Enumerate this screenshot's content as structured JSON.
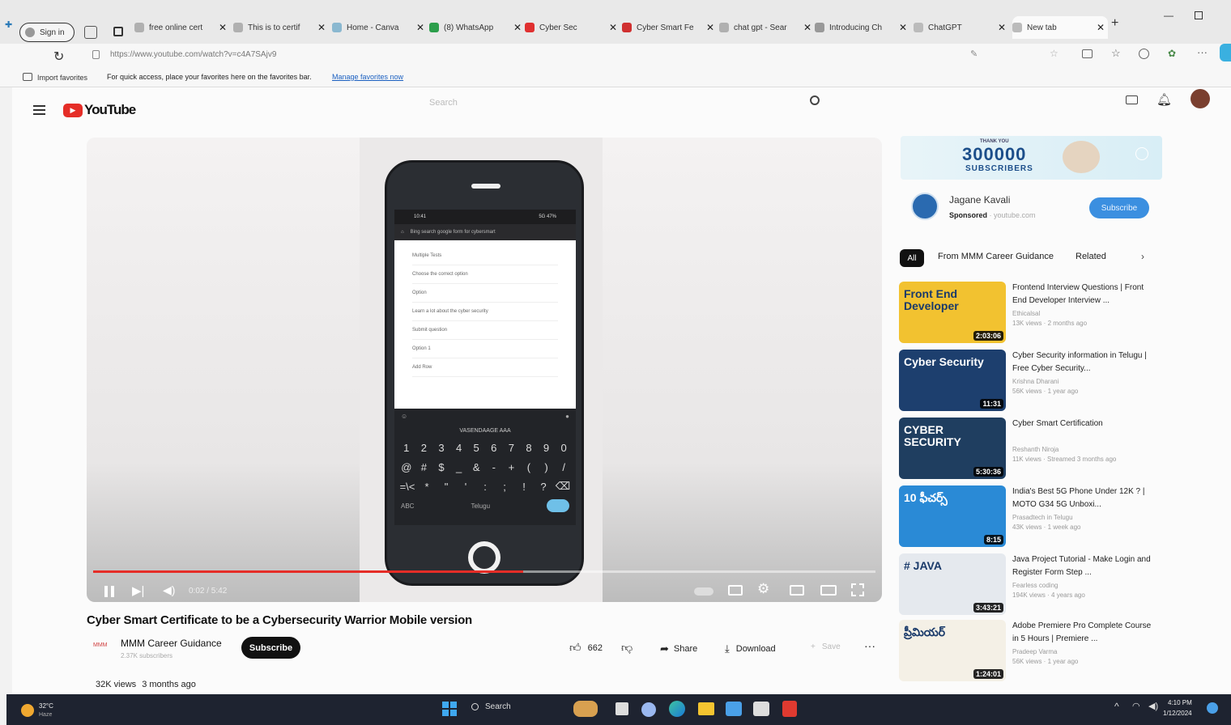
{
  "browser": {
    "sign_in": "Sign in",
    "tabs": [
      {
        "label": "free online cert",
        "fav": "#b0b0b0"
      },
      {
        "label": "This is to certif",
        "fav": "#b0b0b0"
      },
      {
        "label": "Home - Canva",
        "fav": "#8ab8d0"
      },
      {
        "label": "(8) WhatsApp",
        "fav": "#2c9e4b"
      },
      {
        "label": "Cyber Sec",
        "fav": "#e03030"
      },
      {
        "label": "Cyber Smart Fe",
        "fav": "#d03030"
      },
      {
        "label": "chat gpt - Sear",
        "fav": "#b0b0b0"
      },
      {
        "label": "Introducing Ch",
        "fav": "#999999"
      },
      {
        "label": "ChatGPT",
        "fav": "#bbbbbb"
      },
      {
        "label": "New tab",
        "fav": "#bbbbbb"
      }
    ],
    "url": "https://www.youtube.com/watch?v=c4A7SAjv9",
    "favorites_import": "Import favorites",
    "favorites_hint": "For quick access, place your favorites here on the favorites bar.",
    "favorites_link": "Manage favorites now"
  },
  "youtube": {
    "logo": "YouTube",
    "search_placeholder": "Search",
    "ad": {
      "banner_small": "THANK YOU",
      "banner_count": "300000",
      "banner_label": "SUBSCRIBERS",
      "channel": "Jagane Kavali",
      "sponsored": "Sponsored",
      "sponsored_url": "· youtube.com",
      "subscribe": "Subscribe"
    },
    "chips": [
      "All",
      "From MMM Career Guidance",
      "Related"
    ],
    "recommendations": [
      {
        "title": "Frontend Interview Questions | Front End Developer Interview ...",
        "channel": "Ethicalsal",
        "meta": "13K views · 2 months ago",
        "duration": "2:03:06",
        "thumb_text": "Front End Developer",
        "thumb_bg": "#f2c230"
      },
      {
        "title": "Cyber Security information in Telugu | Free Cyber Security...",
        "channel": "Krishna Dharani",
        "meta": "56K views · 1 year ago",
        "duration": "11:31",
        "thumb_text": "Cyber Security",
        "thumb_bg": "#1d3f6e"
      },
      {
        "title": "Cyber Smart Certification",
        "channel": "Reshanth Niroja",
        "meta": "11K views · Streamed 3 months ago",
        "duration": "5:30:36",
        "thumb_text": "CYBER SECURITY",
        "thumb_bg": "#1f3e60"
      },
      {
        "title": "India's Best 5G Phone Under 12K ? | MOTO G34 5G Unboxi...",
        "channel": "Prasadtech in Telugu",
        "meta": "43K views · 1 week ago",
        "duration": "8:15",
        "thumb_text": "10 ఫీచర్స్",
        "thumb_bg": "#2a8ad6"
      },
      {
        "title": "Java Project Tutorial - Make Login and Register Form Step ...",
        "channel": "Fearless coding",
        "meta": "194K views · 4 years ago",
        "duration": "3:43:21",
        "thumb_text": "# JAVA",
        "thumb_bg": "#e5e9ee"
      },
      {
        "title": "Adobe Premiere Pro Complete Course in 5 Hours | Premiere ...",
        "channel": "Pradeep Varma",
        "meta": "56K views · 1 year ago",
        "duration": "1:24:01",
        "thumb_text": "ప్రీమియర్",
        "thumb_bg": "#f4f0e6"
      }
    ],
    "video": {
      "title": "Cyber Smart Certificate to be a Cybersecurity Warrior Mobile version",
      "channel": "MMM Career Guidance",
      "subs": "2.37K subscribers",
      "subscribe": "Subscribe",
      "likes": "662",
      "share": "Share",
      "download": "Download",
      "save": "Save",
      "views": "32K views",
      "age": "3 months ago",
      "time": "0:02 / 5:42",
      "progress": 0.55
    },
    "phone": {
      "status_left": "10:41",
      "status_right": "5G 47%",
      "search_text": "Bing search google form for cybersmart",
      "lines": [
        "Multiple Tests",
        "Choose the correct option",
        "Option",
        "Learn a lot about the cyber security",
        "Submit question",
        "Option 1",
        "Add Row"
      ],
      "kb_lang": "VASENDAAGE AAA",
      "row_nums": [
        "1",
        "2",
        "3",
        "4",
        "5",
        "6",
        "7",
        "8",
        "9",
        "0"
      ],
      "row_sym": [
        "@",
        "#",
        "$",
        "_",
        "&",
        "-",
        "+",
        "(",
        ")",
        "/"
      ],
      "row3": [
        "=\\<",
        "*",
        "\"",
        "'",
        ":",
        ";",
        "!",
        "?",
        "⌫"
      ],
      "row4_left": "ABC",
      "row4_mid": "Telugu"
    }
  },
  "taskbar": {
    "weather_temp": "32°C",
    "weather_desc": "Haze",
    "search": "Search",
    "time": "4:10 PM",
    "date": "1/12/2024"
  }
}
